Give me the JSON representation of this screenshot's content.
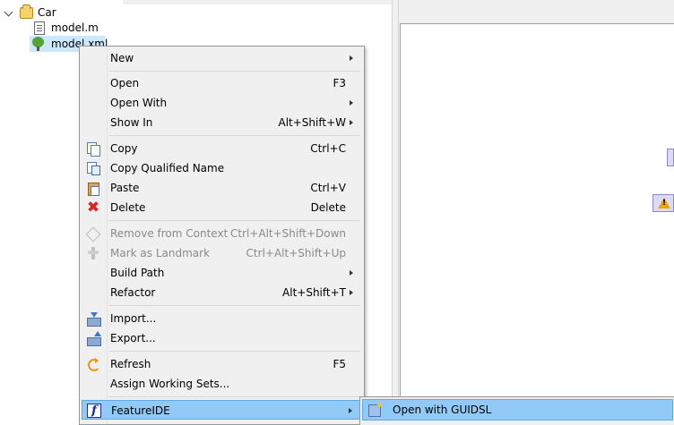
{
  "explorer": {
    "tree": [
      {
        "label": "Car",
        "icon": "project-folder-icon",
        "expanded": true
      },
      {
        "label": "model.m",
        "icon": "text-file-icon"
      },
      {
        "label": "model.xml",
        "icon": "feature-model-icon",
        "selected": true
      }
    ]
  },
  "context_menu": {
    "items": [
      {
        "label": "New",
        "submenu": true
      },
      {
        "label": "Open",
        "shortcut": "F3"
      },
      {
        "label": "Open With",
        "submenu": true
      },
      {
        "label": "Show In",
        "shortcut": "Alt+Shift+W",
        "submenu": true
      },
      {
        "label": "Copy",
        "shortcut": "Ctrl+C",
        "icon": "copy-icon"
      },
      {
        "label": "Copy Qualified Name",
        "icon": "copy-qualified-name-icon"
      },
      {
        "label": "Paste",
        "shortcut": "Ctrl+V",
        "icon": "paste-icon"
      },
      {
        "label": "Delete",
        "shortcut": "Delete",
        "icon": "delete-icon"
      },
      {
        "label": "Remove from Context",
        "shortcut": "Ctrl+Alt+Shift+Down",
        "icon": "remove-context-icon",
        "disabled": true
      },
      {
        "label": "Mark as Landmark",
        "shortcut": "Ctrl+Alt+Shift+Up",
        "icon": "landmark-icon",
        "disabled": true
      },
      {
        "label": "Build Path",
        "submenu": true
      },
      {
        "label": "Refactor",
        "shortcut": "Alt+Shift+T",
        "submenu": true
      },
      {
        "label": "Import...",
        "icon": "import-icon"
      },
      {
        "label": "Export...",
        "icon": "export-icon"
      },
      {
        "label": "Refresh",
        "shortcut": "F5",
        "icon": "refresh-icon"
      },
      {
        "label": "Assign Working Sets..."
      },
      {
        "label": "FeatureIDE",
        "submenu": true,
        "icon": "featureide-icon",
        "highlighted": true
      }
    ],
    "featureide_glyph": "f"
  },
  "submenu": {
    "items": [
      {
        "label": "Open with GUIDSL",
        "icon": "guidsl-icon"
      }
    ]
  },
  "colors": {
    "menu_bg": "#f0f0f0",
    "highlight": "#91c9f7",
    "selection": "#cce8ff",
    "disabled_text": "#8a8a8a"
  }
}
